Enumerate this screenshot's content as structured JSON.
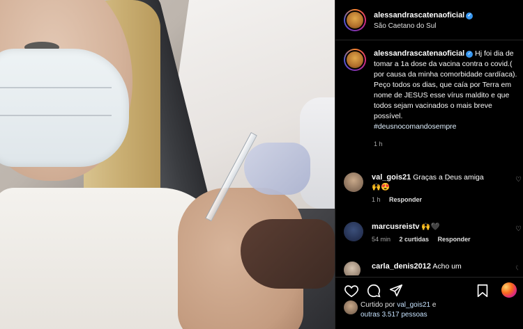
{
  "post": {
    "username": "alessandrascatenaoficial",
    "location": "São Caetano do Sul",
    "caption": "Hj foi dia de tomar a 1a dose da vacina contra o covid.( por causa da minha comorbidade cardíaca). Peço todos os dias, que caía por Terra em nome de JESUS esse vírus maldito e que todos sejam vacinados o mais breve possível.",
    "hashtag": "#deusnocomandosempre",
    "caption_time": "1 h",
    "verified_mark": "✓"
  },
  "comments": [
    {
      "username": "val_gois21",
      "text": "Graças a Deus amiga",
      "emoji": "🙌😍",
      "time": "1 h",
      "reply_label": "Responder",
      "likes_label": ""
    },
    {
      "username": "marcusreistv",
      "text": "🙌🖤",
      "time": "54 min",
      "likes_label": "2 curtidas",
      "reply_label": "Responder"
    },
    {
      "username": "carla_denis2012",
      "text": "Acho um"
    }
  ],
  "likes": {
    "prefix": "Curtido por",
    "user": "val_gois21",
    "suffix": "e",
    "others": "outras 3.517 pessoas"
  },
  "icons": [
    "heart-icon",
    "comment-icon",
    "share-icon",
    "bookmark-icon",
    "brand-badge-icon"
  ]
}
